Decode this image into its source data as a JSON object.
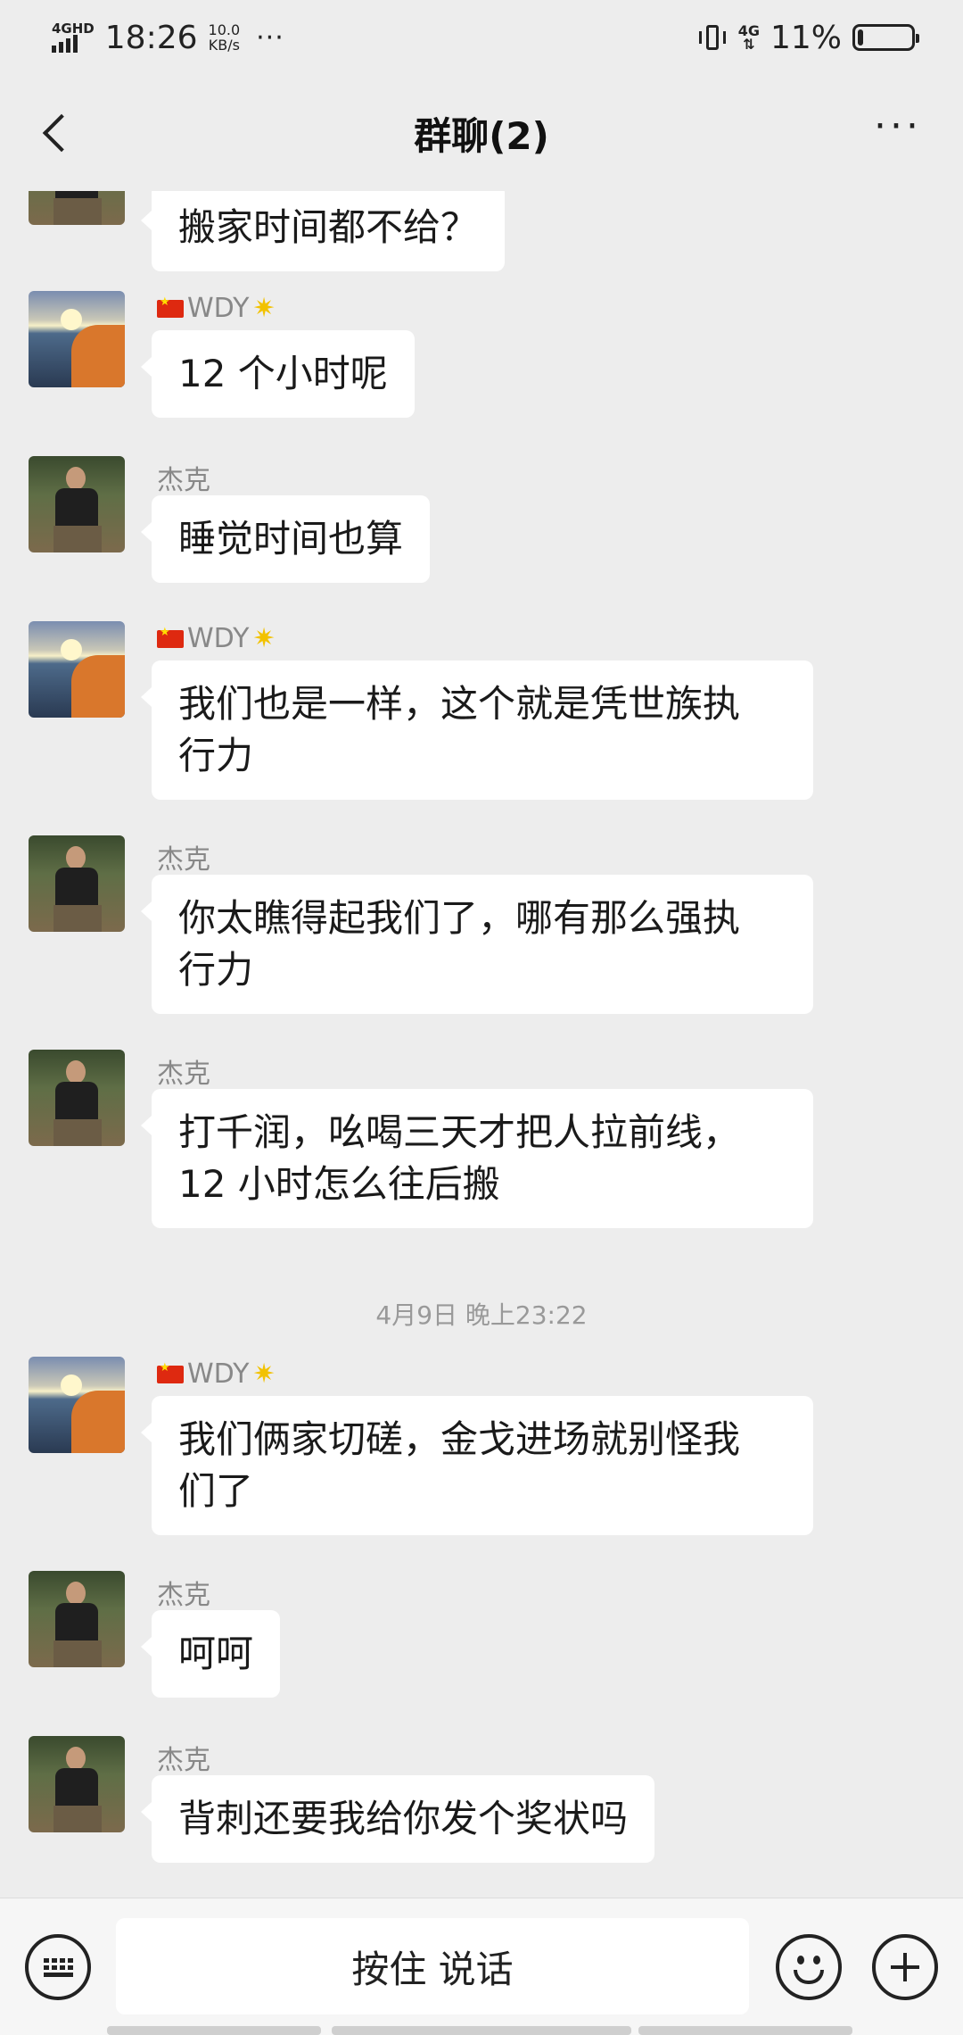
{
  "status_bar": {
    "network_type": "4GHD",
    "time": "18:26",
    "speed_value": "10.0",
    "speed_unit": "KB/s",
    "overflow": "···",
    "data_network": "4G",
    "battery": "11%",
    "battery_level": 0.11
  },
  "header": {
    "title": "群聊(2)",
    "more": "···"
  },
  "messages": [
    {
      "sender": "",
      "text": "搬家时间都不给？",
      "avatar": "jk-avatar"
    },
    {
      "sender": "WDY",
      "text": "12 个小时呢",
      "avatar": "wdy-avatar"
    },
    {
      "sender": "杰克",
      "text": "睡觉时间也算",
      "avatar": "jk-avatar"
    },
    {
      "sender": "WDY",
      "line1": "我们也是一样，这个就是凭世族执",
      "line2": "行力",
      "avatar": "wdy-avatar"
    },
    {
      "sender": "杰克",
      "line1": "你太瞧得起我们了，哪有那么强执",
      "line2": "行力",
      "avatar": "jk-avatar"
    },
    {
      "sender": "杰克",
      "line1": "打千润，吆喝三天才把人拉前线，",
      "line2": "12 小时怎么往后搬",
      "avatar": "jk-avatar"
    },
    {
      "sender": "WDY",
      "line1": "我们俩家切磋，金戈进场就别怪我",
      "line2": "们了",
      "avatar": "wdy-avatar"
    },
    {
      "sender": "杰克",
      "text": "呵呵",
      "avatar": "jk-avatar"
    },
    {
      "sender": "杰克",
      "text": "背刺还要我给你发个奖状吗",
      "avatar": "jk-avatar"
    }
  ],
  "timestamp": "4月9日 晚上23:22",
  "input_bar": {
    "hold_to_talk": "按住 说话"
  }
}
